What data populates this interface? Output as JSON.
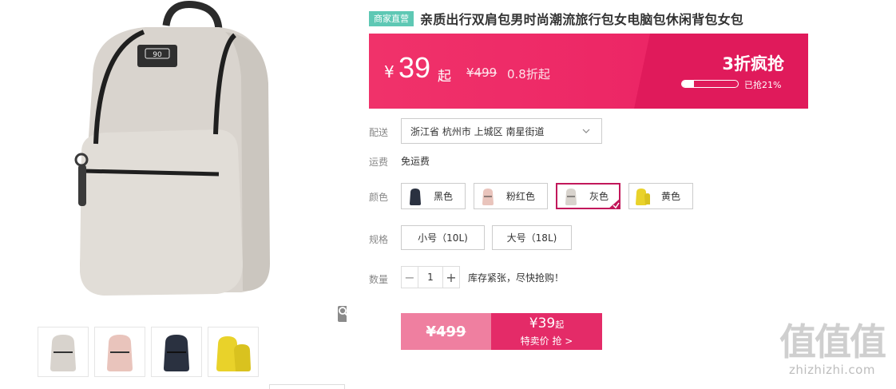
{
  "product": {
    "tag": "商家直营",
    "title": "亲质出行双肩包男时尚潮流旅行包女电脑包休闲背包女包",
    "image_badge": "90"
  },
  "banner": {
    "currency": "¥",
    "price": "39",
    "price_suffix": "起",
    "original_price": "¥499",
    "discount": "0.8折起",
    "flash_title": "3折疯抢",
    "progress_fraction": 0.21,
    "progress_text": "已抢21%"
  },
  "delivery": {
    "label": "配送",
    "address": "浙江省 杭州市 上城区 南星街道"
  },
  "shipping": {
    "label": "运费",
    "value": "免运费"
  },
  "colors": {
    "label": "颜色",
    "options": [
      {
        "name": "黑色",
        "swatch": "#2a3140"
      },
      {
        "name": "粉红色",
        "swatch": "#e9c4bc"
      },
      {
        "name": "灰色",
        "swatch": "#d8d3cd"
      },
      {
        "name": "黄色",
        "swatch": "#e9d22a"
      }
    ],
    "selected": "灰色"
  },
  "sizes": {
    "label": "规格",
    "options": [
      "小号（10L)",
      "大号（18L)"
    ]
  },
  "quantity": {
    "label": "数量",
    "value": "1",
    "minus": "−",
    "plus": "+",
    "note": "库存紧张，尽快抢购！"
  },
  "buy": {
    "original_price": "¥499",
    "sale_price": "¥39",
    "sale_suffix": "起",
    "cta": "特卖价 抢 >"
  },
  "watermark": {
    "logo": "值值值",
    "url": "zhizhizhi.com"
  },
  "thumbnails": [
    {
      "name": "gray",
      "color": "#d8d3cd"
    },
    {
      "name": "pink",
      "color": "#e9c4bc"
    },
    {
      "name": "navy",
      "color": "#2a3140"
    },
    {
      "name": "yellow",
      "color": "#e9d22a"
    }
  ],
  "colors_theme": {
    "accent": "#ea1f63",
    "tag": "#5ec8b4",
    "selected_border": "#c2185b"
  }
}
